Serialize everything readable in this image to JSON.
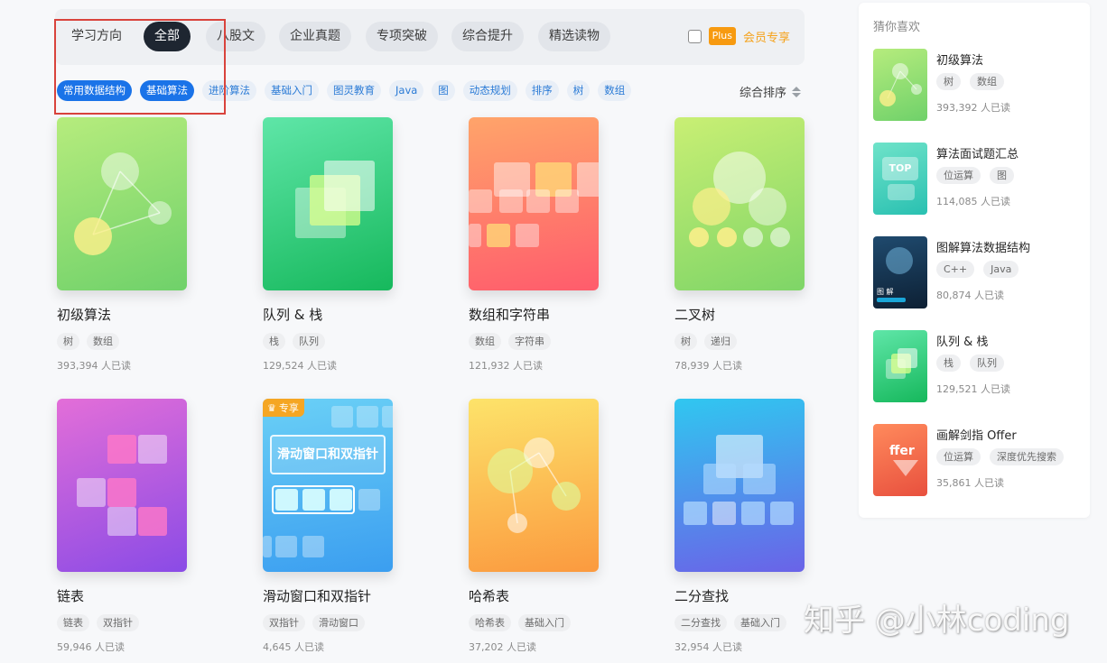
{
  "filter_bar": {
    "label": "学习方向",
    "categories": [
      "全部",
      "八股文",
      "企业真题",
      "专项突破",
      "综合提升",
      "精选读物"
    ],
    "plus_badge": "Plus",
    "plus_text": "会员专享"
  },
  "tags": [
    "常用数据结构",
    "基础算法",
    "进阶算法",
    "基础入门",
    "图灵教育",
    "Java",
    "图",
    "动态规划",
    "排序",
    "树",
    "数组"
  ],
  "sort_label": "综合排序",
  "cards": [
    {
      "title": "初级算法",
      "tags": [
        "树",
        "数组"
      ],
      "reads": "393,394 人已读"
    },
    {
      "title": "队列 & 栈",
      "tags": [
        "栈",
        "队列"
      ],
      "reads": "129,524 人已读"
    },
    {
      "title": "数组和字符串",
      "tags": [
        "数组",
        "字符串"
      ],
      "reads": "121,932 人已读"
    },
    {
      "title": "二叉树",
      "tags": [
        "树",
        "递归"
      ],
      "reads": "78,939 人已读"
    },
    {
      "title": "链表",
      "tags": [
        "链表",
        "双指针"
      ],
      "reads": "59,946 人已读"
    },
    {
      "title": "滑动窗口和双指针",
      "tags": [
        "双指针",
        "滑动窗口"
      ],
      "reads": "4,645 人已读",
      "vip": "专享",
      "cover_text": "滑动窗口和双指针"
    },
    {
      "title": "哈希表",
      "tags": [
        "哈希表",
        "基础入门"
      ],
      "reads": "37,202 人已读"
    },
    {
      "title": "二分查找",
      "tags": [
        "二分查找",
        "基础入门"
      ],
      "reads": "32,954 人已读"
    }
  ],
  "sidebar": {
    "heading": "猜你喜欢",
    "items": [
      {
        "title": "初级算法",
        "tags": [
          "树",
          "数组"
        ],
        "reads": "393,392 人已读"
      },
      {
        "title": "算法面试题汇总",
        "tags": [
          "位运算",
          "图"
        ],
        "reads": "114,085 人已读",
        "thumb_text": "TOP"
      },
      {
        "title": "图解算法数据结构",
        "tags": [
          "C++",
          "Java"
        ],
        "reads": "80,874 人已读",
        "thumb_text": "图 解"
      },
      {
        "title": "队列 & 栈",
        "tags": [
          "栈",
          "队列"
        ],
        "reads": "129,521 人已读"
      },
      {
        "title": "画解剑指 Offer",
        "tags": [
          "位运算",
          "深度优先搜索"
        ],
        "reads": "35,861 人已读",
        "thumb_text": "ffer"
      }
    ]
  },
  "watermark": "知乎 @小林coding",
  "colors": {
    "active_pill": "#1e2631",
    "active_tag": "#1a73e8",
    "plus": "#f79a10",
    "highlight_box": "#d9433c"
  }
}
